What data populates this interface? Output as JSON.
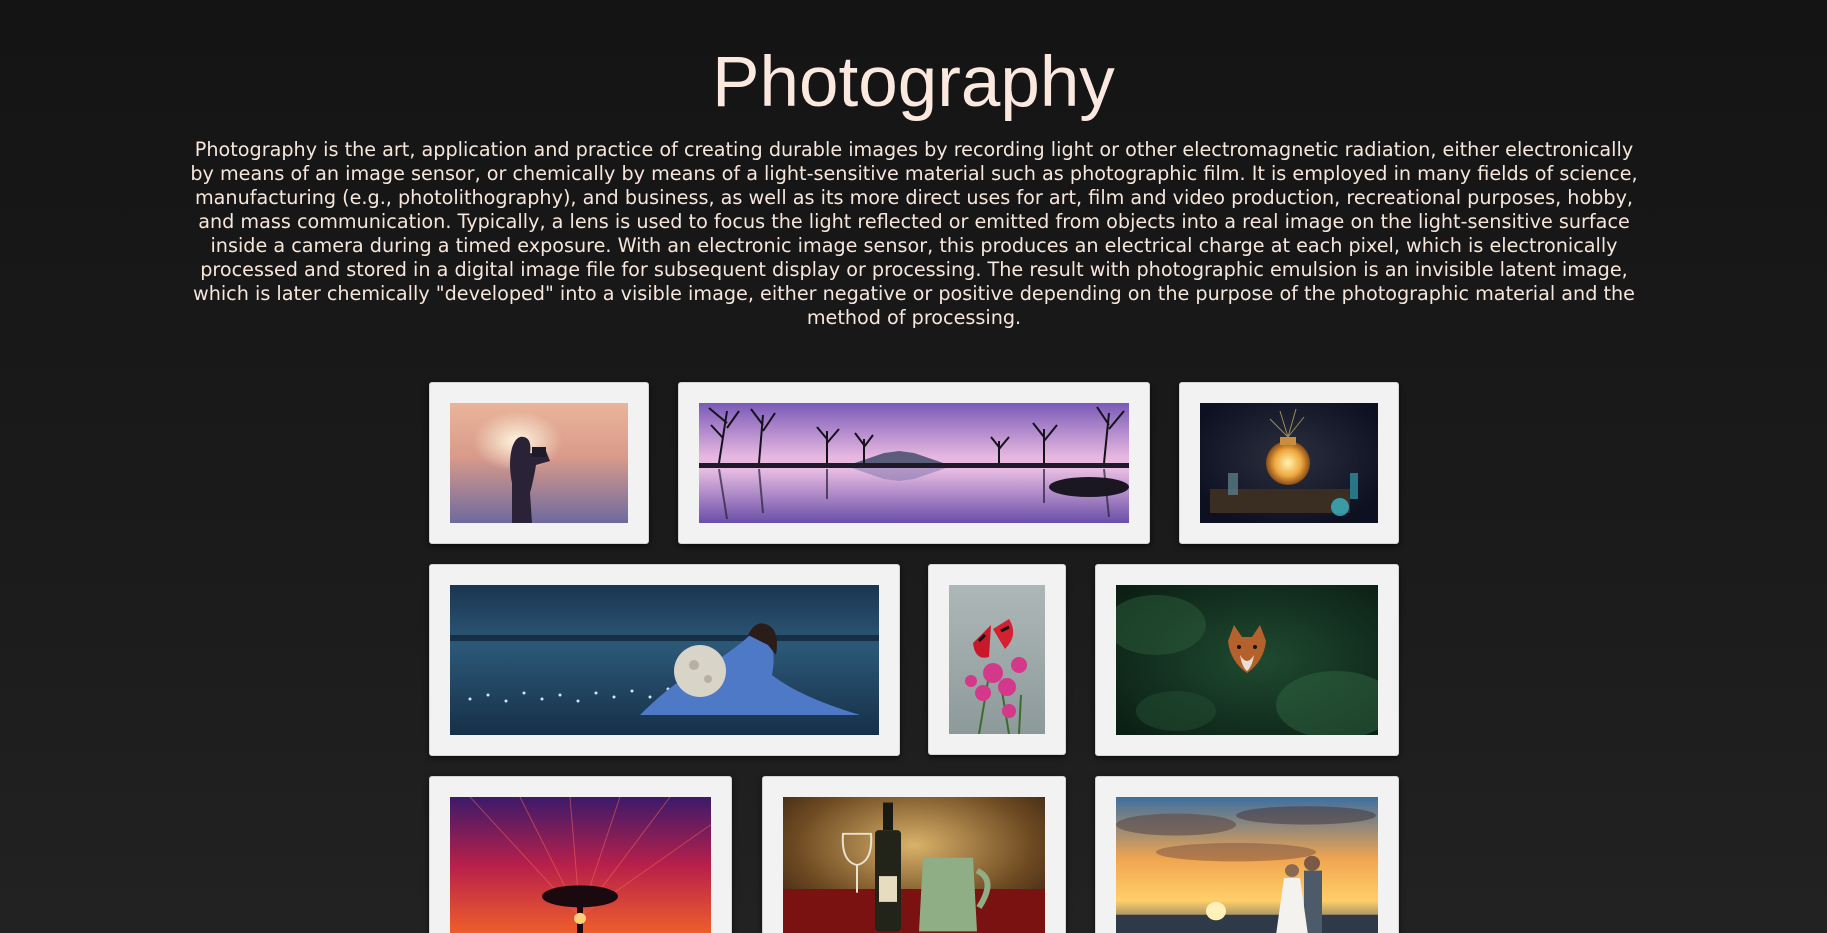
{
  "page": {
    "title": "Photography",
    "description": "Photography is the art, application and practice of creating durable images by recording light or other electromagnetic radiation, either electronically by means of an image sensor, or chemically by means of a light-sensitive material such as photographic film. It is employed in many fields of science, manufacturing (e.g., photolithography), and business, as well as its more direct uses for art, film and video production, recreational purposes, hobby, and mass communication. Typically, a lens is used to focus the light reflected or emitted from objects into a real image on the light-sensitive surface inside a camera during a timed exposure. With an electronic image sensor, this produces an electrical charge at each pixel, which is electronically processed and stored in a digital image file for subsequent display or processing. The result with photographic emulsion is an invisible latent image, which is later chemically \"developed\" into a visible image, either negative or positive depending on the purpose of the photographic material and the method of processing."
  },
  "colors": {
    "background": "#141414",
    "text": "#f6e6dc",
    "frame": "#f2f2f2"
  },
  "gallery": [
    {
      "name": "photo-photographer-silhouette",
      "subject": "woman photographer silhouette at sunset"
    },
    {
      "name": "photo-mountain-lake-reflection",
      "subject": "pink sky lake reflection with bare trees and mountain"
    },
    {
      "name": "photo-glowing-jar-still-life",
      "subject": "glowing jar still life on dark background"
    },
    {
      "name": "photo-woman-with-moon",
      "subject": "woman in blue dress holding moon by the sea"
    },
    {
      "name": "photo-butterfly-flowers",
      "subject": "red butterfly on pink flowers"
    },
    {
      "name": "photo-fox-in-foliage",
      "subject": "fox hidden in green foliage"
    },
    {
      "name": "photo-tree-red-sky",
      "subject": "tree silhouette under red sky"
    },
    {
      "name": "photo-wine-still-life",
      "subject": "wine bottle, glass and jug still life"
    },
    {
      "name": "photo-wedding-sunset",
      "subject": "wedding couple at sunset by the sea"
    }
  ]
}
